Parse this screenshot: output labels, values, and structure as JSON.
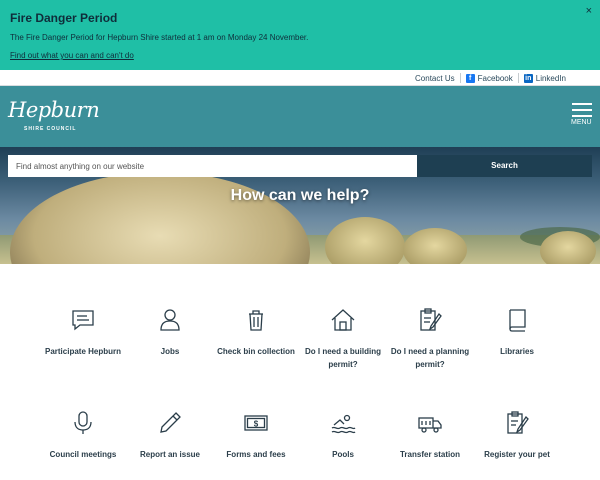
{
  "alert": {
    "title": "Fire Danger Period",
    "text": "The Fire Danger Period for Hepburn Shire started at 1 am on Monday 24 November.",
    "link": "Find out what you can and can't do",
    "close": "×"
  },
  "topbar": {
    "contact": "Contact Us",
    "facebook": "Facebook",
    "linkedin": "LinkedIn"
  },
  "header": {
    "logo_script": "Hepburn",
    "logo_sub": "SHIRE COUNCIL",
    "menu_label": "MENU"
  },
  "search": {
    "placeholder": "Find almost anything on our website",
    "button": "Search"
  },
  "hero": {
    "title": "How can we help?"
  },
  "colors": {
    "alert_bg": "#1fbfa6",
    "header_bg": "#3b8f99",
    "search_button_bg": "#1e3f52",
    "icon_stroke": "#2b3e4a"
  },
  "tiles": [
    {
      "label": "Participate Hepburn",
      "icon": "chat-icon"
    },
    {
      "label": "Jobs",
      "icon": "person-icon"
    },
    {
      "label": "Check bin collection",
      "icon": "bin-icon"
    },
    {
      "label": "Do I need a building permit?",
      "icon": "house-icon"
    },
    {
      "label": "Do I need a planning permit?",
      "icon": "clipboard-pencil-icon"
    },
    {
      "label": "Libraries",
      "icon": "book-icon"
    },
    {
      "label": "Council meetings",
      "icon": "microphone-icon"
    },
    {
      "label": "Report an issue",
      "icon": "pencil-icon"
    },
    {
      "label": "Forms and fees",
      "icon": "money-icon"
    },
    {
      "label": "Pools",
      "icon": "swimmer-icon"
    },
    {
      "label": "Transfer station",
      "icon": "truck-icon"
    },
    {
      "label": "Register your pet",
      "icon": "clipboard-paw-icon"
    }
  ]
}
